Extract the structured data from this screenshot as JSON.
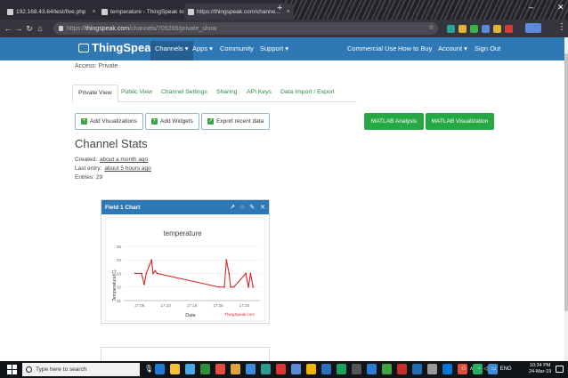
{
  "browser": {
    "tabs": [
      {
        "label": "192.168.43.64/test/five.php"
      },
      {
        "label": "temperature - ThingSpeak IoT"
      },
      {
        "label": "https://thingspeak.com/channe..."
      }
    ],
    "new_tab": "+",
    "address_prefix": "https://",
    "address_host": "thingspeak.com",
    "address_path": "/channels/705265/private_show",
    "window_controls": {
      "minimize": "–",
      "close": "✕"
    }
  },
  "navbar": {
    "brand": "ThingSpeak",
    "trademark": "™",
    "items": [
      {
        "label": "Channels ▾"
      },
      {
        "label": "Apps ▾"
      },
      {
        "label": "Community"
      },
      {
        "label": "Support ▾"
      }
    ],
    "right_items": [
      {
        "label": "Commercial Use"
      },
      {
        "label": "How to Buy"
      },
      {
        "label": "Account ▾"
      },
      {
        "label": "Sign Out"
      }
    ]
  },
  "page": {
    "access": "Access: Private",
    "tabs": [
      {
        "label": "Private View"
      },
      {
        "label": "Public View"
      },
      {
        "label": "Channel Settings"
      },
      {
        "label": "Sharing"
      },
      {
        "label": "API Keys"
      },
      {
        "label": "Data Import / Export"
      }
    ],
    "buttons": {
      "add_visualizations": "Add Visualizations",
      "add_widgets": "Add Widgets",
      "export_recent": "Export recent data",
      "matlab_analysis": "MATLAB Analysis",
      "matlab_visualization": "MATLAB Visualization"
    },
    "stats_title": "Channel Stats",
    "created_label": "Created:",
    "created_value": "about a month ago",
    "last_entry_label": "Last entry:",
    "last_entry_value": "about 5 hours ago",
    "entries": "Entries: 29"
  },
  "widget": {
    "title": "Field 1 Chart",
    "icons": [
      "external-link-icon",
      "comment-icon",
      "pencil-icon",
      "close-icon"
    ],
    "icon_glyphs": {
      "external": "↗",
      "comment": "○",
      "edit": "✎",
      "close": "✕"
    }
  },
  "chart_data": {
    "type": "line",
    "title": "temperature",
    "xlabel": "Date",
    "ylabel": "Temperature(C)",
    "ylim": [
      31,
      35
    ],
    "yticks": [
      31,
      32,
      33,
      34,
      35
    ],
    "xticks": [
      "17:05",
      "17:10",
      "17:15",
      "17:20",
      "17:25"
    ],
    "x_minutes": [
      4.2,
      5.4,
      5.9,
      6.3,
      7.3,
      7.6,
      8.0,
      8.4,
      20.2,
      21.2,
      21.6,
      22.1,
      22.4,
      23.0,
      25.3,
      25.8,
      26.2,
      26.7
    ],
    "values": [
      33,
      33,
      32.2,
      33,
      34,
      33,
      33.2,
      33,
      32,
      32,
      34,
      33,
      32,
      32,
      33,
      32,
      33,
      32
    ],
    "series_color": "#d62728",
    "credit": "ThingSpeak.com"
  },
  "taskbar": {
    "search_placeholder": "Type here to search",
    "tray_lang": "ENG",
    "time": "10:34 PM",
    "date": "24-Mar-19"
  }
}
